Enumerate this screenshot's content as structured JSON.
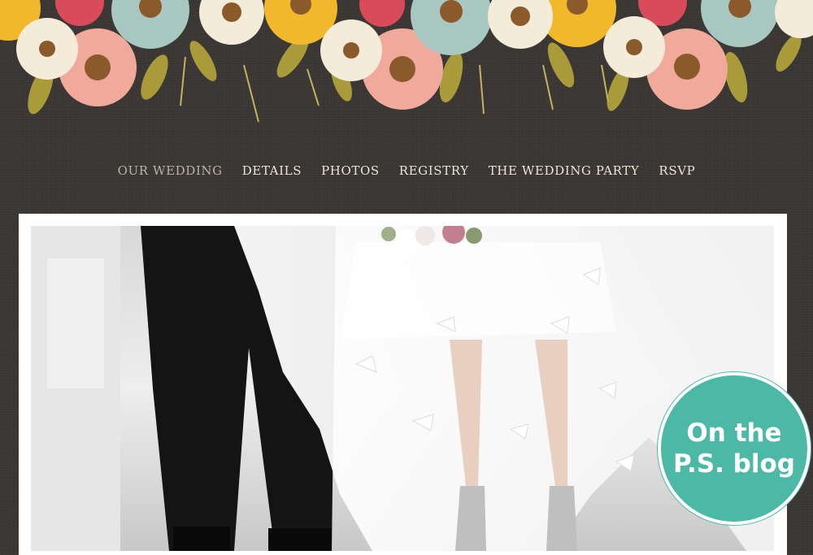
{
  "nav": {
    "items": [
      {
        "label": "OUR WEDDING",
        "active": true
      },
      {
        "label": "DETAILS",
        "active": false
      },
      {
        "label": "PHOTOS",
        "active": false
      },
      {
        "label": "REGISTRY",
        "active": false
      },
      {
        "label": "THE WEDDING PARTY",
        "active": false
      },
      {
        "label": "RSVP",
        "active": false
      }
    ]
  },
  "badge": {
    "line1": "On the",
    "line2": "P.S. blog",
    "color": "#4bb9a5"
  },
  "colors": {
    "background": "#3a3634",
    "nav_text": "#ece4d6",
    "nav_active": "#b9b2a6"
  }
}
